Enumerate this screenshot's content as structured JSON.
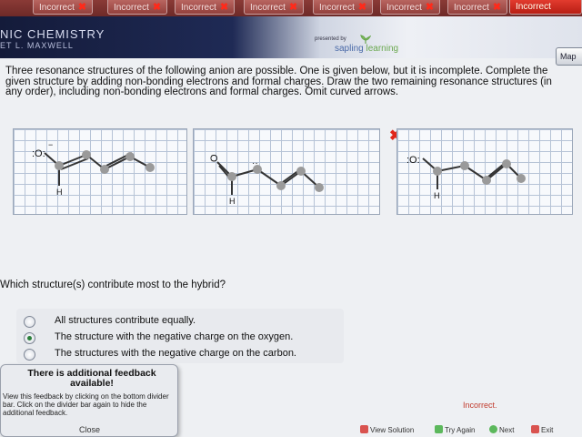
{
  "tabs": [
    {
      "label": "Incorrect",
      "state": "incorrect"
    },
    {
      "label": "Incorrect",
      "state": "incorrect"
    },
    {
      "label": "Incorrect",
      "state": "incorrect"
    },
    {
      "label": "Incorrect",
      "state": "incorrect"
    },
    {
      "label": "Incorrect",
      "state": "incorrect"
    },
    {
      "label": "Incorrect",
      "state": "incorrect"
    },
    {
      "label": "Incorrect",
      "state": "active"
    }
  ],
  "header": {
    "course_title": "NIC CHEMISTRY",
    "course_author": "ET L. MAXWELL",
    "presented_by": "presented by",
    "brand_a": "sapling",
    "brand_b": "learning",
    "map_button": "Map"
  },
  "question": {
    "text": "Three resonance structures of the following anion are possible. One is given below, but it is incomplete. Complete the given structure by adding non-bonding electrons and formal charges. Draw the two remaining resonance structures (in any order), including non-bonding electrons and formal charges. Omit curved arrows."
  },
  "structures": [
    {
      "oxygen": ":O:",
      "charge": "−",
      "hydrogen": "H"
    },
    {
      "oxygen": "O",
      "charge": "",
      "hydrogen": "H",
      "lone_pair": "··"
    },
    {
      "oxygen": ":O:",
      "charge": "",
      "hydrogen": "H"
    }
  ],
  "hybrid_question": "Which structure(s) contribute most to the hybrid?",
  "options": [
    {
      "label": "All structures contribute equally.",
      "selected": false
    },
    {
      "label": "The structure with the negative charge on the oxygen.",
      "selected": true
    },
    {
      "label": "The structures with the negative charge on the carbon.",
      "selected": false
    }
  ],
  "feedback": {
    "title": "There is additional feedback available!",
    "body": "View this feedback by clicking on the bottom divider bar. Click on the divider bar again to hide the additional feedback.",
    "close": "Close"
  },
  "status": "Incorrect.",
  "bottom_bar": {
    "view_solution": "View Solution",
    "try_again": "Try Again",
    "next": "Next",
    "exit": "Exit"
  },
  "colors": {
    "incorrect": "#ff2a1a",
    "bond": "#333333",
    "atom_node": "#9a9a9a",
    "selected_radio": "#2a7f3a"
  }
}
